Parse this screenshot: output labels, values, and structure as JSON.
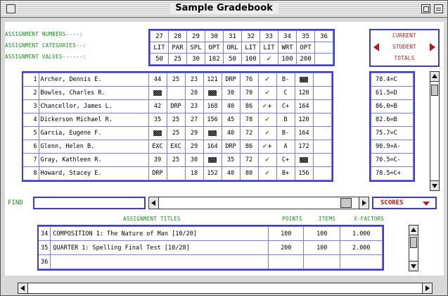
{
  "window": {
    "title": "Sample Gradebook"
  },
  "header": {
    "row_labels": [
      "ASSIGNMENT NUMBERS----:",
      "ASSIGNMENT CATEGORIES--:",
      "ASSIGNMENT VALUES------:"
    ],
    "numbers": [
      "27",
      "28",
      "29",
      "30",
      "31",
      "32",
      "33",
      "34",
      "35",
      "36"
    ],
    "categories": [
      "LIT",
      "PAR",
      "SPL",
      "OPT",
      "ORL",
      "LIT",
      "LIT",
      "WRT",
      "OPT",
      ""
    ],
    "values": [
      "50",
      "25",
      "30",
      "182",
      "50",
      "100",
      "✓",
      "100",
      "200",
      ""
    ]
  },
  "current_totals": {
    "line1": "CURRENT",
    "line2": "STUDENT",
    "line3": "TOTALS"
  },
  "students": [
    {
      "num": "1",
      "name": "Archer, Dennis E.",
      "scores": [
        "44",
        "25",
        "23",
        "121",
        "DRP",
        "76",
        "✓",
        "B-",
        "■",
        ""
      ],
      "total": "78.4=C"
    },
    {
      "num": "2",
      "name": "Bowles, Charles R.",
      "scores": [
        "■",
        "",
        "20",
        "■",
        "30",
        "70",
        "✓",
        "C",
        "120",
        ""
      ],
      "total": "61.5=D"
    },
    {
      "num": "3",
      "name": "Chancellor, James L.",
      "scores": [
        "42",
        "DRP",
        "23",
        "168",
        "40",
        "86",
        "✓+",
        "C+",
        "164",
        ""
      ],
      "total": "86.0=B"
    },
    {
      "num": "4",
      "name": "Dickerson Michael R.",
      "scores": [
        "35",
        "25",
        "27",
        "156",
        "45",
        "78",
        "✓",
        "B",
        "120",
        ""
      ],
      "total": "82.6=B"
    },
    {
      "num": "5",
      "name": "Garcia, Eugene F.",
      "scores": [
        "■",
        "25",
        "29",
        "■",
        "40",
        "72",
        "✓",
        "B-",
        "164",
        ""
      ],
      "total": "75.7=C"
    },
    {
      "num": "6",
      "name": "Glenn, Helen B.",
      "scores": [
        "EXC",
        "EXC",
        "29",
        "164",
        "DRP",
        "86",
        "✓+",
        "A",
        "172",
        ""
      ],
      "total": "90.9=A-"
    },
    {
      "num": "7",
      "name": "Gray, Kathleen R.",
      "scores": [
        "39",
        "25",
        "30",
        "■",
        "35",
        "72",
        "✓",
        "C+",
        "■",
        ""
      ],
      "total": "70.5=C-"
    },
    {
      "num": "8",
      "name": "Howard, Stacey E.",
      "scores": [
        "DRP",
        "",
        "18",
        "152",
        "40",
        "80",
        "✓",
        "B+",
        "156",
        ""
      ],
      "total": "78.5=C+"
    }
  ],
  "find": {
    "label": "FIND",
    "value": ""
  },
  "scores_popup": {
    "label": "SCORES"
  },
  "titles_header": {
    "titles": "ASSIGNMENT TITLES",
    "points": "POINTS",
    "items": "ITEMS",
    "factors": "X-FACTORS"
  },
  "assignments": [
    {
      "num": "34",
      "title": "COMPOSITION 1: The Nature of Man [10/20]",
      "points": "100",
      "items": "100",
      "factor": "1.000"
    },
    {
      "num": "35",
      "title": "QUARTER 1: Spelling Final Test   [10/28]",
      "points": "200",
      "items": "100",
      "factor": "2.000"
    },
    {
      "num": "36",
      "title": "",
      "points": "",
      "items": "",
      "factor": ""
    }
  ],
  "colors": {
    "accent_blue": "#3c3ccc",
    "label_green": "#1a8a1a",
    "alert_red": "#c21717"
  }
}
